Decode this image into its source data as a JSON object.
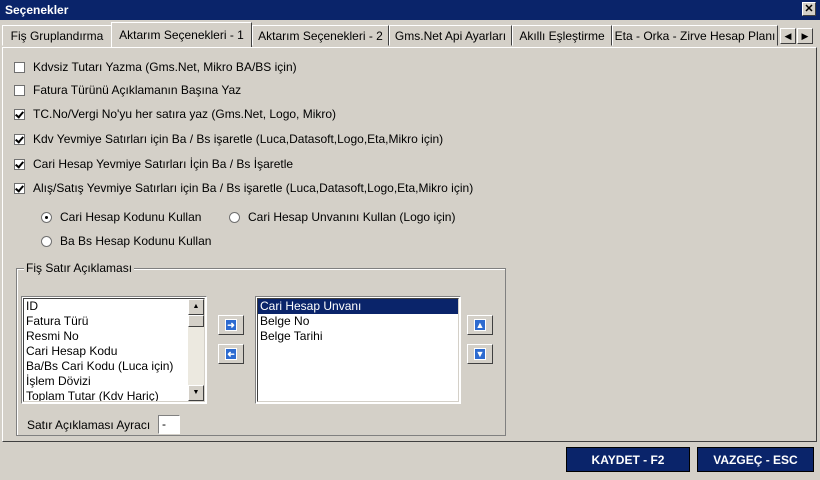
{
  "window": {
    "title": "Seçenekler"
  },
  "tabs": [
    {
      "label": "Fiş Gruplandırma"
    },
    {
      "label": "Aktarım Seçenekleri - 1"
    },
    {
      "label": "Aktarım Seçenekleri - 2"
    },
    {
      "label": "Gms.Net Api Ayarları"
    },
    {
      "label": "Akıllı Eşleştirme"
    },
    {
      "label": "Eta - Orka - Zirve Hesap Planı"
    }
  ],
  "checkboxes": [
    {
      "label": "Kdvsiz Tutarı Yazma (Gms.Net, Mikro BA/BS için)",
      "checked": false
    },
    {
      "label": "Fatura Türünü Açıklamanın Başına Yaz",
      "checked": false
    },
    {
      "label": "TC.No/Vergi No'yu her satıra yaz (Gms.Net, Logo, Mikro)",
      "checked": true
    },
    {
      "label": "Kdv Yevmiye Satırları için Ba / Bs işaretle (Luca,Datasoft,Logo,Eta,Mikro için)",
      "checked": true
    },
    {
      "label": "Cari Hesap Yevmiye Satırları İçin Ba / Bs İşaretle",
      "checked": true
    },
    {
      "label": "Alış/Satış Yevmiye Satırları için Ba / Bs işaretle (Luca,Datasoft,Logo,Eta,Mikro için)",
      "checked": true
    }
  ],
  "radios": [
    {
      "label": "Cari Hesap Kodunu Kullan",
      "selected": true
    },
    {
      "label": "Cari Hesap Unvanını Kullan (Logo için)",
      "selected": false
    },
    {
      "label": "Ba Bs Hesap Kodunu Kullan",
      "selected": false
    }
  ],
  "group": {
    "legend": "Fiş Satır Açıklaması",
    "available": [
      "ID",
      "Fatura Türü",
      "Resmi No",
      "Cari Hesap Kodu",
      "Ba/Bs Cari Kodu (Luca için)",
      "İşlem Dövizi",
      "Toplam Tutar (Kdv Hariç)"
    ],
    "selected": [
      "Cari Hesap Unvanı",
      "Belge No",
      "Belge Tarihi"
    ],
    "selected_highlight": "Cari Hesap Unvanı",
    "separator_label": "Satır Açıklaması Ayracı",
    "separator_value": "-"
  },
  "buttons": {
    "save": "KAYDET - F2",
    "cancel": "VAZGEÇ - ESC"
  },
  "colors": {
    "titlebar": "#0a246a",
    "selection": "#0a246a",
    "face": "#d4d0c8"
  }
}
